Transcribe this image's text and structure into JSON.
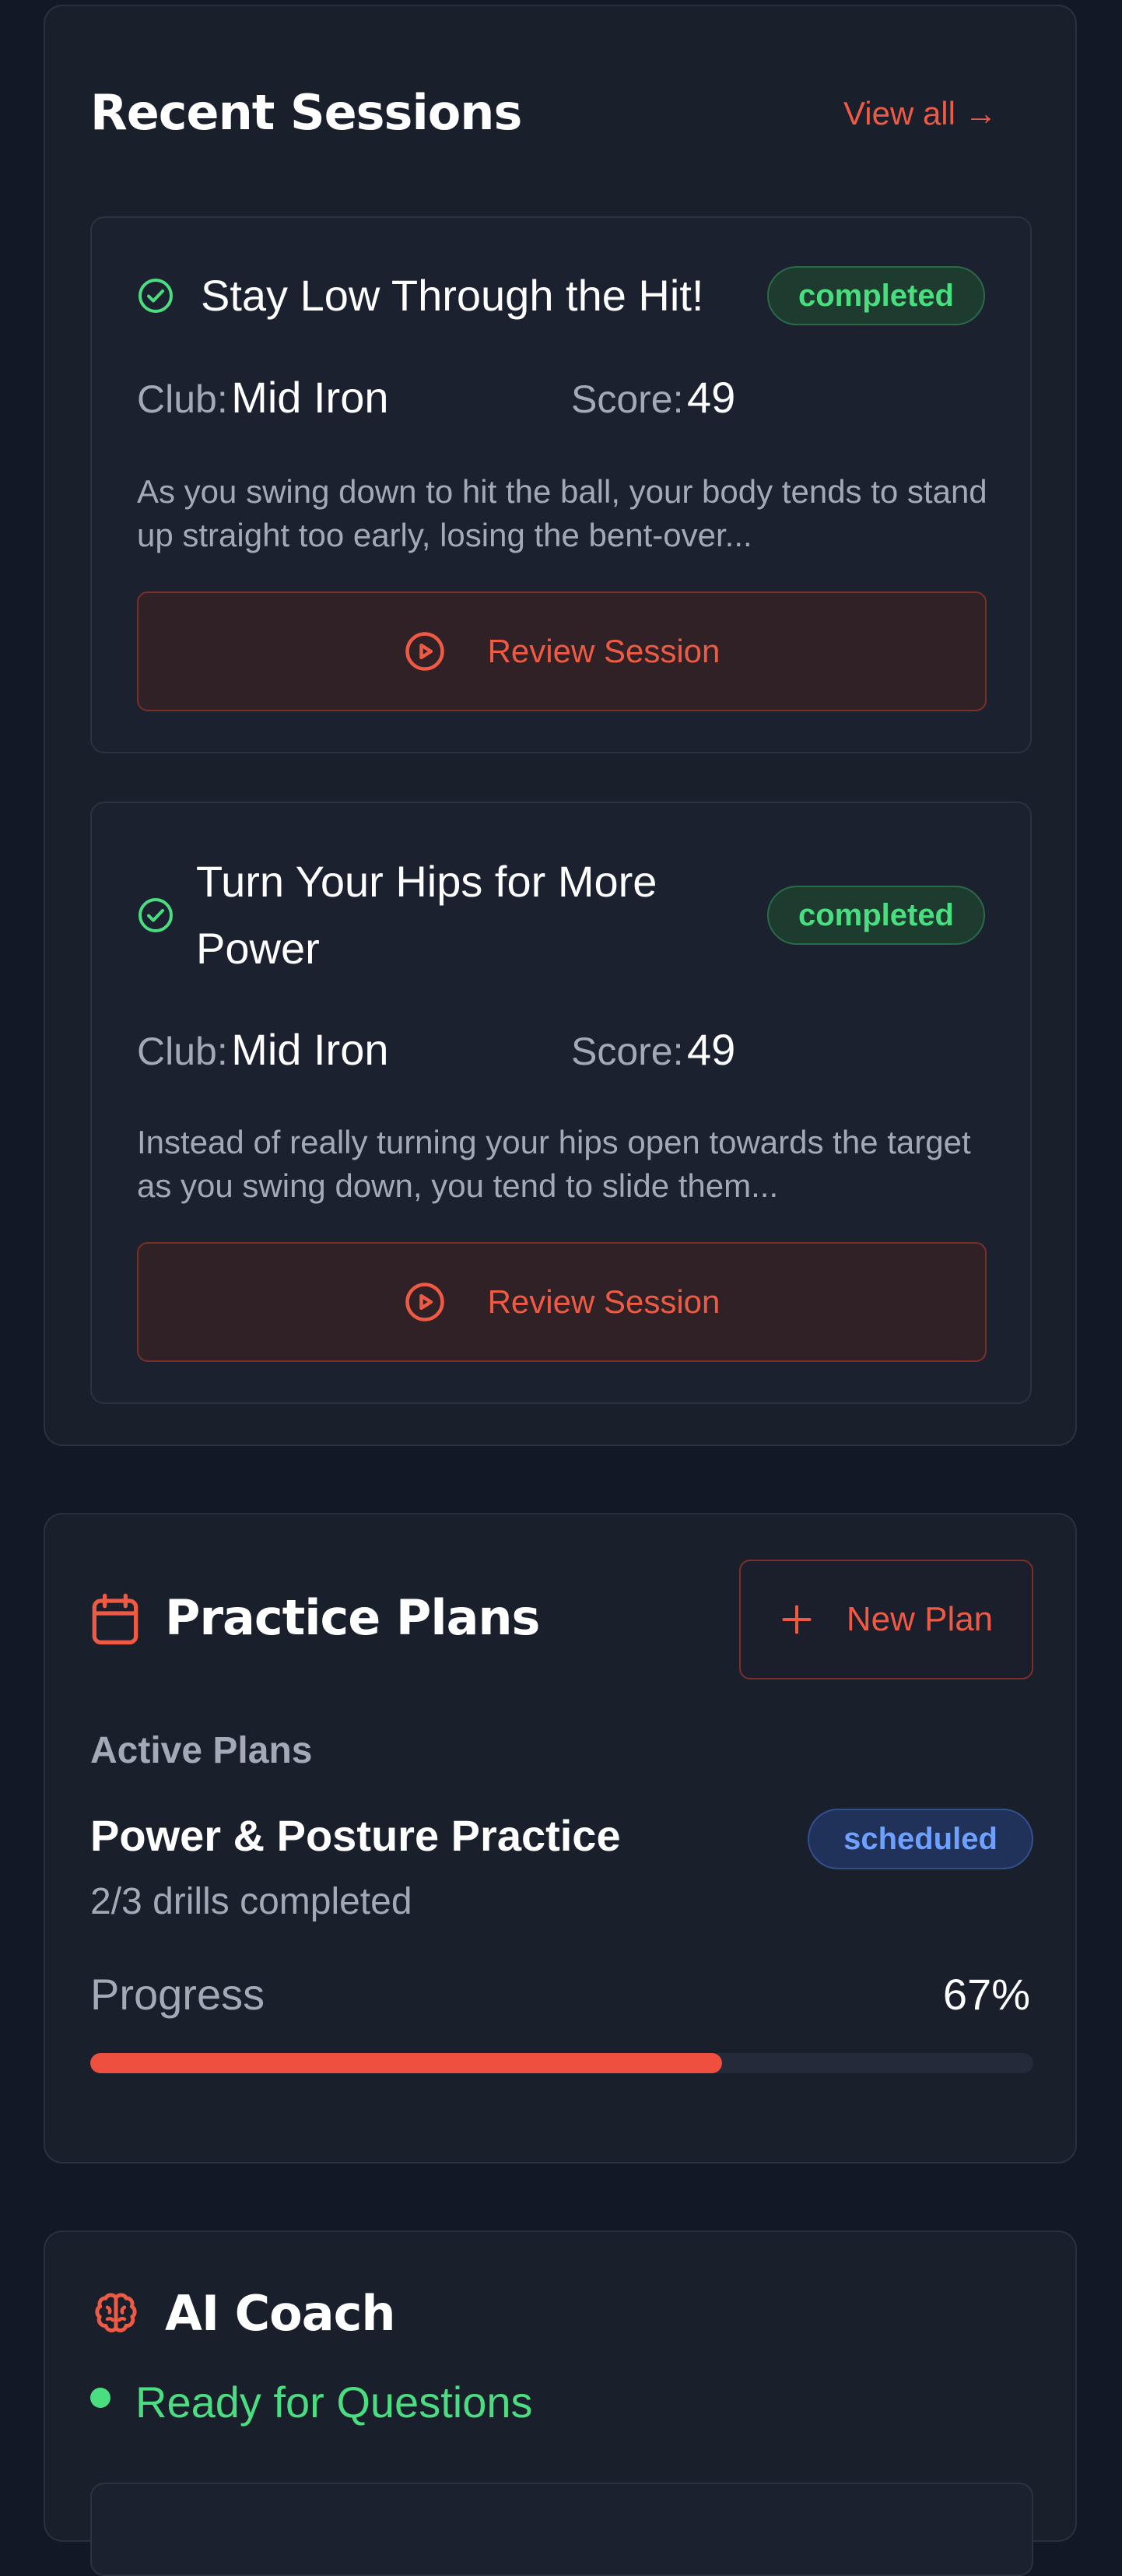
{
  "recent_sessions": {
    "title": "Recent Sessions",
    "view_all": "View all →",
    "sessions": [
      {
        "title": "Stay Low Through the Hit!",
        "status": "completed",
        "club_label": "Club:",
        "club": "Mid Iron",
        "score_label": "Score:",
        "score": "49",
        "description": "As you swing down to hit the ball, your body tends to stand up straight too early, losing the bent-over...",
        "review_label": "Review Session"
      },
      {
        "title": "Turn Your Hips for More Power",
        "status": "completed",
        "club_label": "Club:",
        "club": "Mid Iron",
        "score_label": "Score:",
        "score": "49",
        "description": "Instead of really turning your hips open towards the target as you swing down, you tend to slide them...",
        "review_label": "Review Session"
      }
    ]
  },
  "practice_plans": {
    "title": "Practice Plans",
    "new_plan_label": "New Plan",
    "section_label": "Active Plans",
    "plan": {
      "name": "Power & Posture Practice",
      "status": "scheduled",
      "drills": "2/3 drills completed",
      "progress_label": "Progress",
      "progress_text": "67%",
      "progress_value": 0.67
    }
  },
  "ai_coach": {
    "title": "AI Coach",
    "status": "Ready for Questions"
  },
  "colors": {
    "accent": "#ef5a45",
    "success": "#4ade80",
    "info": "#6ea0ff",
    "background": "#121826",
    "card": "#1a1f2c"
  },
  "icons": {
    "session_status": "check-circle-icon",
    "review": "play-circle-icon",
    "plans": "calendar-icon",
    "new_plan": "plus-icon",
    "coach": "brain-icon"
  }
}
